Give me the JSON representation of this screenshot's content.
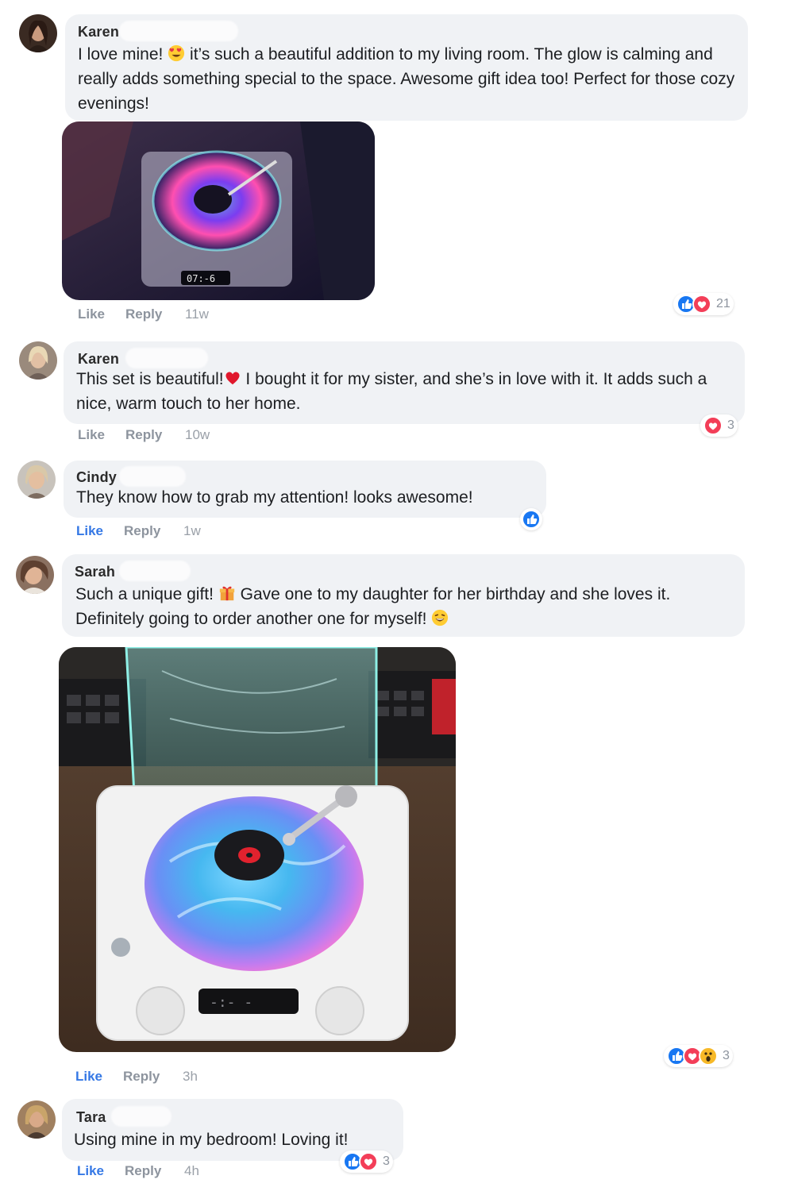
{
  "colors": {
    "bubble_bg": "#f0f2f5",
    "like_blue": "#1877f2",
    "love_red": "#f33e58",
    "wow_yellow": "#f7b928",
    "action_gray": "#8d949e",
    "active_blue": "#3578e5"
  },
  "comments": [
    {
      "author": "Karen",
      "text_a": "I love mine! ",
      "emoji": "heart-eyes-emoji",
      "text_b": " it’s such a beautiful addition to my living room. The glow is calming and really adds something special to the space. Awesome gift idea too! Perfect for those cozy evenings!",
      "actions": {
        "like": "Like",
        "reply": "Reply",
        "time": "11w"
      },
      "reactions": {
        "icons": [
          "like-icon",
          "love-icon"
        ],
        "count": "21"
      }
    },
    {
      "author": "Karen",
      "text_a": "This set is beautiful!",
      "emoji": "red-heart-emoji",
      "text_b": " I bought it for my sister, and she’s in love with it. It adds such a nice, warm touch to her home.",
      "actions": {
        "like": "Like",
        "reply": "Reply",
        "time": "10w"
      },
      "reactions": {
        "icons": [
          "love-icon"
        ],
        "count": "3"
      }
    },
    {
      "author": "Cindy",
      "text_a": "They know how to grab my attention! looks awesome!",
      "actions": {
        "like": "Like",
        "reply": "Reply",
        "time": "1w"
      },
      "reactions": {
        "icons": [
          "like-icon"
        ],
        "count": ""
      }
    },
    {
      "author": "Sarah",
      "text_a": "Such a unique gift! ",
      "emoji": "gift-emoji",
      "text_b": " Gave one to my daughter for her birthday and she loves it. Definitely going to order another one for myself! ",
      "emoji2": "grinning-emoji",
      "actions": {
        "like": "Like",
        "reply": "Reply",
        "time": "3h"
      },
      "reactions": {
        "icons": [
          "like-icon",
          "love-icon",
          "wow-icon"
        ],
        "count": "3"
      }
    },
    {
      "author": "Tara",
      "text_a": "Using mine in my bedroom! Loving it!",
      "actions": {
        "like": "Like",
        "reply": "Reply",
        "time": "4h"
      },
      "reactions": {
        "icons": [
          "like-icon",
          "love-icon"
        ],
        "count": "3"
      }
    }
  ]
}
